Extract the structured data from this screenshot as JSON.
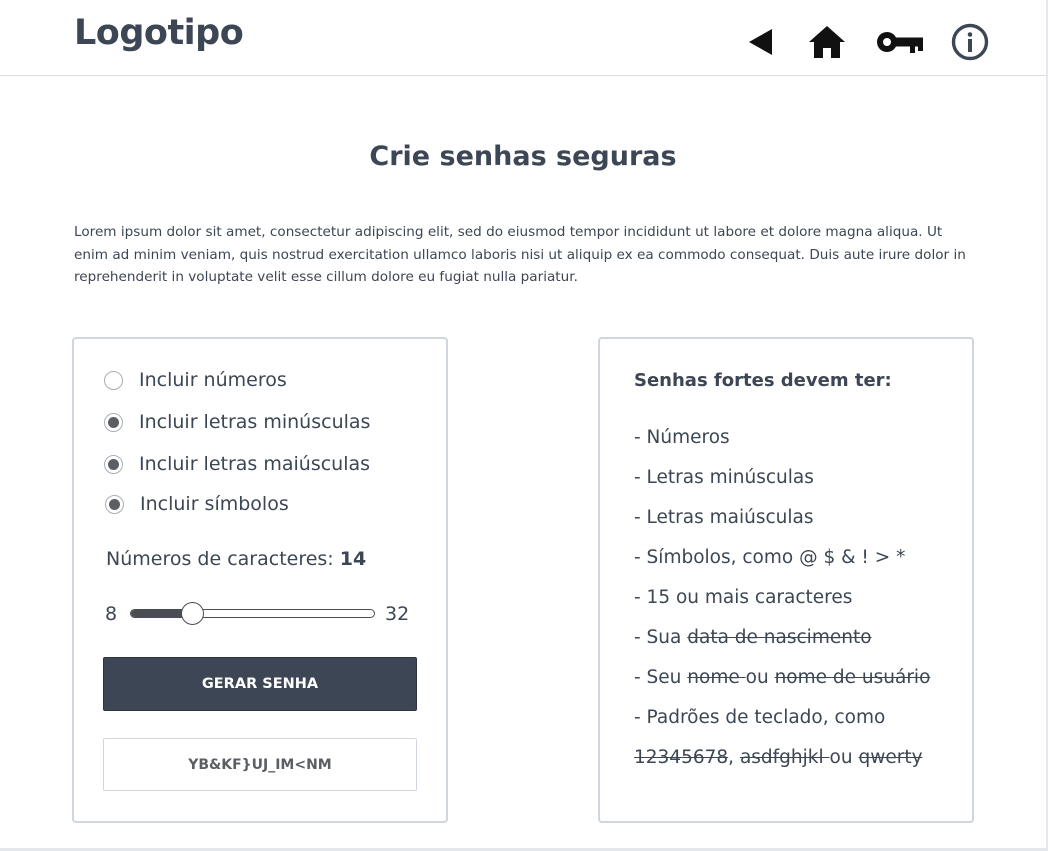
{
  "header": {
    "logo": "Logotipo",
    "icons": [
      "back-icon",
      "home-icon",
      "key-icon",
      "info-icon"
    ]
  },
  "main": {
    "title": "Crie senhas seguras",
    "intro": "Lorem ipsum dolor sit amet, consectetur adipiscing elit, sed do eiusmod tempor incididunt ut labore et dolore magna aliqua. Ut enim ad minim veniam, quis nostrud exercitation ullamco laboris nisi ut aliquip ex ea commodo consequat. Duis aute irure dolor in reprehenderit in voluptate velit esse cillum dolore eu fugiat nulla pariatur."
  },
  "generator": {
    "options": [
      {
        "label": "Incluir números",
        "checked": false
      },
      {
        "label": "Incluir letras minúsculas",
        "checked": true
      },
      {
        "label": "Incluir letras maiúsculas",
        "checked": true
      },
      {
        "label": "Incluir símbolos",
        "checked": true
      }
    ],
    "length_label": "Números de caracteres:",
    "length_value": "14",
    "slider": {
      "min": "8",
      "max": "32",
      "value": 14
    },
    "button_label": "GERAR SENHA",
    "password": "YB&KF}UJ_IM<NM"
  },
  "tips": {
    "heading": "Senhas fortes devem ter:",
    "items": {
      "numbers": "- Números",
      "lowercase": "- Letras minúsculas",
      "uppercase": "- Letras maiúsculas",
      "symbols": "- Símbolos, como @ $ & ! > *",
      "length": "- 15 ou mais caracteres"
    },
    "birth": {
      "prefix": "- Sua ",
      "struck": "data de nascimento"
    },
    "name": {
      "prefix": "- Seu ",
      "struck1": "nome ",
      "middle": "ou ",
      "struck2": "nome de usuário"
    },
    "keyboard": {
      "intro": "- Padrões de teclado, como",
      "struck1": "12345678",
      "sep": ", ",
      "struck2": "asdfghjkl ",
      "or": "ou ",
      "struck3": "qwerty"
    }
  },
  "colors": {
    "primary": "#3d4654",
    "border": "#cfd6de",
    "radio_fill": "#5b5e63",
    "background": "#ffffff"
  }
}
